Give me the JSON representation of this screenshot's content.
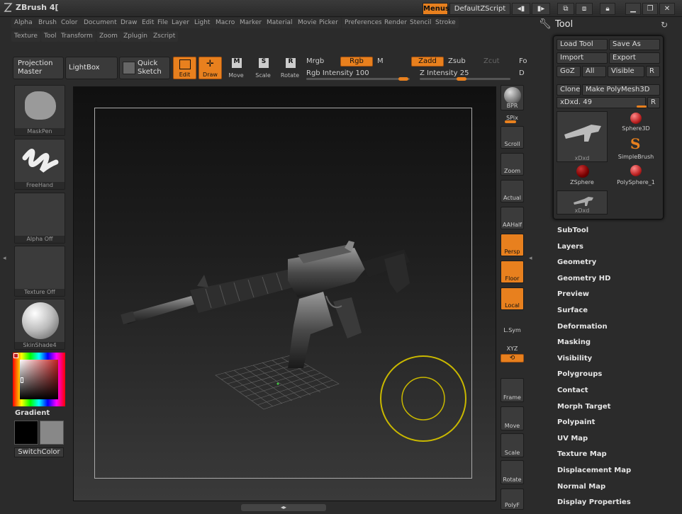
{
  "title": "ZBrush 4[",
  "topright": {
    "menus": "Menus",
    "script": "DefaultZScript"
  },
  "menubar": [
    "Alpha",
    "Brush",
    "Color",
    "Document",
    "Draw",
    "Edit",
    "File",
    "Layer",
    "Light",
    "Macro",
    "Marker",
    "Material",
    "Movie",
    "Picker",
    "Preferences",
    "Render",
    "Stencil",
    "Stroke"
  ],
  "menubar2": [
    "Texture",
    "Tool",
    "Transform",
    "Zoom",
    "Zplugin",
    "Zscript"
  ],
  "toolbar": {
    "projection_master": "Projection Master",
    "lightbox": "LightBox",
    "quick_sketch": "Quick Sketch",
    "edit": "Edit",
    "draw": "Draw",
    "move": "Move",
    "scale": "Scale",
    "rotate": "Rotate",
    "mrgb": "Mrgb",
    "rgb": "Rgb",
    "m": "M",
    "zadd": "Zadd",
    "zsub": "Zsub",
    "zcut": "Zcut",
    "fo": "Fo",
    "rgb_intensity": "Rgb Intensity 100",
    "z_intensity": "Z Intensity 25",
    "d": "D"
  },
  "left_shelf": {
    "brush": "MaskPen",
    "stroke": "FreeHand",
    "alpha": "Alpha Off",
    "texture": "Texture Off",
    "material": "SkinShade4",
    "gradient": "Gradient",
    "switchcolor": "SwitchColor"
  },
  "right_column": [
    "BPR",
    "SPix",
    "Scroll",
    "Zoom",
    "Actual",
    "AAHalf",
    "Persp",
    "Floor",
    "Local",
    "L.Sym",
    "XYZ",
    "Frame",
    "Move",
    "Scale",
    "Rotate",
    "PolyF"
  ],
  "tool_panel": {
    "header": "Tool",
    "load_tool": "Load Tool",
    "save_as": "Save As",
    "import": "Import",
    "export": "Export",
    "goz": "GoZ",
    "all": "All",
    "visible": "Visible",
    "r": "R",
    "clone": "Clone",
    "make_polymesh": "Make PolyMesh3D",
    "current_tool": "xDxd. 49",
    "thumbs": [
      "xDxd",
      "Sphere3D",
      "SimpleBrush",
      "ZSphere",
      "PolySphere_1",
      "xDxd"
    ]
  },
  "subpalettes": [
    "SubTool",
    "Layers",
    "Geometry",
    "Geometry HD",
    "Preview",
    "Surface",
    "Deformation",
    "Masking",
    "Visibility",
    "Polygroups",
    "Contact",
    "Morph Target",
    "Polypaint",
    "UV Map",
    "Texture Map",
    "Displacement Map",
    "Normal Map",
    "Display Properties"
  ],
  "colors": {
    "accent": "#e8801e",
    "bg": "#2b2b2b"
  }
}
